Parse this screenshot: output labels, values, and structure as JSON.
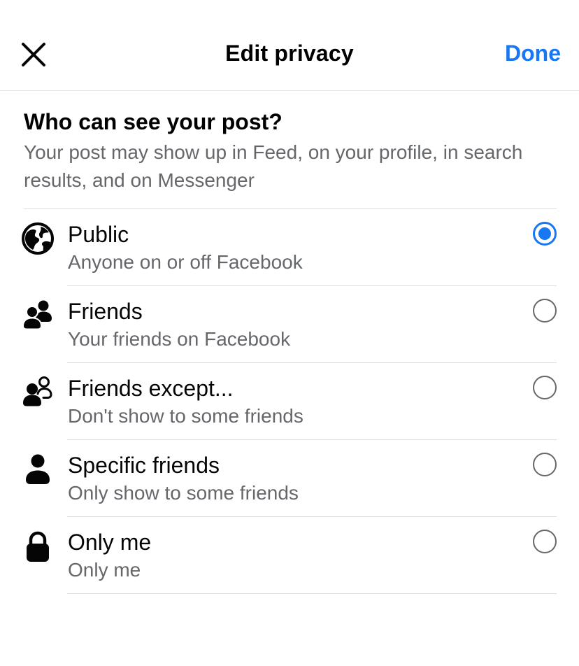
{
  "header": {
    "title": "Edit privacy",
    "done_label": "Done",
    "close_icon": "close-icon",
    "accent_color": "#1877f2"
  },
  "intro": {
    "title": "Who can see your post?",
    "description": "Your post may show up in Feed, on your profile, in search results, and on Messenger"
  },
  "options": [
    {
      "icon": "globe-icon",
      "title": "Public",
      "subtitle": "Anyone on or off Facebook",
      "selected": true
    },
    {
      "icon": "friends-icon",
      "title": "Friends",
      "subtitle": "Your friends on Facebook",
      "selected": false
    },
    {
      "icon": "friends-except-icon",
      "title": "Friends except...",
      "subtitle": "Don't show to some friends",
      "selected": false
    },
    {
      "icon": "person-icon",
      "title": "Specific friends",
      "subtitle": "Only show to some friends",
      "selected": false
    },
    {
      "icon": "lock-icon",
      "title": "Only me",
      "subtitle": "Only me",
      "selected": false
    }
  ]
}
